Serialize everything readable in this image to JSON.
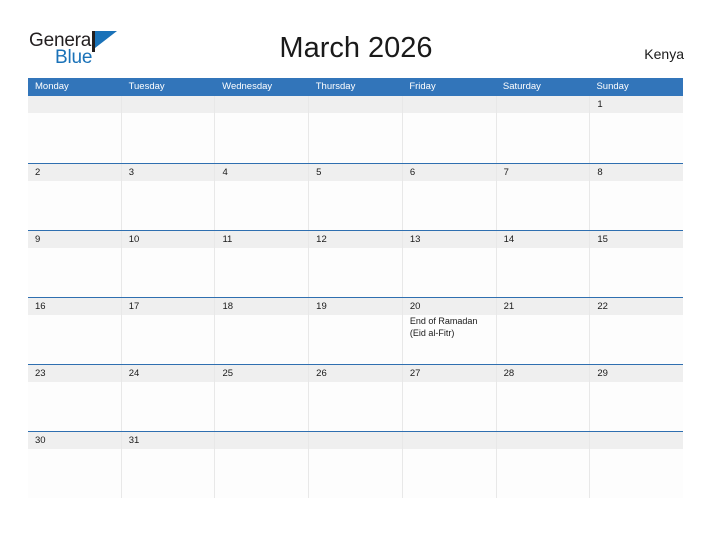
{
  "header": {
    "logo": {
      "word_one": "General",
      "word_two": "Blue"
    },
    "title": "March 2026",
    "country": "Kenya"
  },
  "calendar": {
    "weekdays": [
      "Monday",
      "Tuesday",
      "Wednesday",
      "Thursday",
      "Friday",
      "Saturday",
      "Sunday"
    ],
    "weeks": [
      {
        "days": [
          {
            "number": "",
            "events": []
          },
          {
            "number": "",
            "events": []
          },
          {
            "number": "",
            "events": []
          },
          {
            "number": "",
            "events": []
          },
          {
            "number": "",
            "events": []
          },
          {
            "number": "",
            "events": []
          },
          {
            "number": "1",
            "events": []
          }
        ]
      },
      {
        "days": [
          {
            "number": "2",
            "events": []
          },
          {
            "number": "3",
            "events": []
          },
          {
            "number": "4",
            "events": []
          },
          {
            "number": "5",
            "events": []
          },
          {
            "number": "6",
            "events": []
          },
          {
            "number": "7",
            "events": []
          },
          {
            "number": "8",
            "events": []
          }
        ]
      },
      {
        "days": [
          {
            "number": "9",
            "events": []
          },
          {
            "number": "10",
            "events": []
          },
          {
            "number": "11",
            "events": []
          },
          {
            "number": "12",
            "events": []
          },
          {
            "number": "13",
            "events": []
          },
          {
            "number": "14",
            "events": []
          },
          {
            "number": "15",
            "events": []
          }
        ]
      },
      {
        "days": [
          {
            "number": "16",
            "events": []
          },
          {
            "number": "17",
            "events": []
          },
          {
            "number": "18",
            "events": []
          },
          {
            "number": "19",
            "events": []
          },
          {
            "number": "20",
            "events": [
              "End of Ramadan",
              "(Eid al-Fitr)"
            ]
          },
          {
            "number": "21",
            "events": []
          },
          {
            "number": "22",
            "events": []
          }
        ]
      },
      {
        "days": [
          {
            "number": "23",
            "events": []
          },
          {
            "number": "24",
            "events": []
          },
          {
            "number": "25",
            "events": []
          },
          {
            "number": "26",
            "events": []
          },
          {
            "number": "27",
            "events": []
          },
          {
            "number": "28",
            "events": []
          },
          {
            "number": "29",
            "events": []
          }
        ]
      },
      {
        "days": [
          {
            "number": "30",
            "events": []
          },
          {
            "number": "31",
            "events": []
          },
          {
            "number": "",
            "events": []
          },
          {
            "number": "",
            "events": []
          },
          {
            "number": "",
            "events": []
          },
          {
            "number": "",
            "events": []
          },
          {
            "number": "",
            "events": []
          }
        ]
      }
    ]
  },
  "colors": {
    "header_blue": "#3275ba",
    "row_rule_blue": "#2f6fb0",
    "band_gray": "#efefef",
    "logo_blue": "#1a72b8",
    "text_dark": "#1a1a1a"
  }
}
